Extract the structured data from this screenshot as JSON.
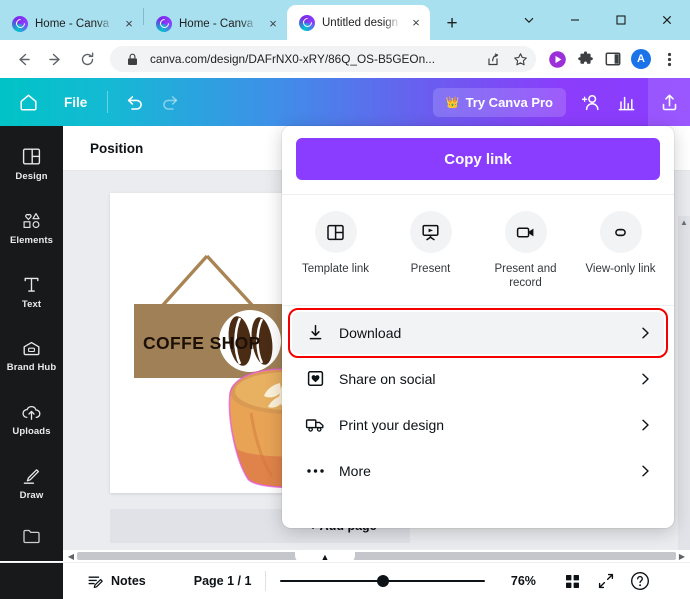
{
  "browser": {
    "tabs": [
      {
        "title": "Home - Canva",
        "active": false,
        "favicon": "canva-favicon",
        "close": "×"
      },
      {
        "title": "Home - Canva",
        "active": false,
        "favicon": "canva-favicon",
        "close": "×"
      },
      {
        "title": "Untitled design",
        "active": true,
        "favicon": "canva-favicon",
        "close": "×"
      }
    ],
    "new_tab_label": "+",
    "window_controls": {
      "tab_search": "chevron-down-icon",
      "minimize": "minimize-icon",
      "maximize": "maximize-icon",
      "close": "close-icon"
    },
    "toolbar": {
      "back": "back-arrow-icon",
      "forward": "forward-arrow-icon",
      "reload": "reload-icon",
      "lock": "lock-icon",
      "url": "canva.com/design/DAFrNX0-xRY/86Q_OS-B5GEOn...",
      "share": "share-icon",
      "bookmark": "star-icon",
      "extensions": [
        "play-circle-icon",
        "puzzle-extension-icon",
        "side-panel-icon"
      ],
      "avatar_initial": "A",
      "menu": "three-dot-menu-icon"
    }
  },
  "canva_header": {
    "home": "home-icon",
    "file_label": "File",
    "undo": "undo-icon",
    "redo": "redo-icon",
    "try_pro_label": "Try Canva Pro",
    "crown": "👑",
    "collaborate": "add-collaborator-icon",
    "analytics": "analytics-icon",
    "share_upload": "share-upload-icon"
  },
  "sidebar": {
    "items": [
      {
        "label": "Design",
        "icon": "design-icon"
      },
      {
        "label": "Elements",
        "icon": "elements-icon"
      },
      {
        "label": "Text",
        "icon": "text-icon"
      },
      {
        "label": "Brand Hub",
        "icon": "brand-hub-icon"
      },
      {
        "label": "Uploads",
        "icon": "uploads-icon"
      },
      {
        "label": "Draw",
        "icon": "draw-icon"
      },
      {
        "label": "",
        "icon": "folder-icon"
      }
    ]
  },
  "editor": {
    "position_label": "Position",
    "add_page_label": "+ Add page",
    "canvas": {
      "sign_text": "COFFE SHOP",
      "sign_color": "#a08056",
      "bean_color": "#4a2c14",
      "cup_color": "#e8a355"
    }
  },
  "share_panel": {
    "copy_link_label": "Copy link",
    "copy_link_color": "#8b3dff",
    "quick_actions": [
      {
        "label": "Template link",
        "icon": "template-link-icon"
      },
      {
        "label": "Present",
        "icon": "present-icon"
      },
      {
        "label": "Present and record",
        "icon": "present-record-icon"
      },
      {
        "label": "View-only link",
        "icon": "view-only-link-icon"
      }
    ],
    "menu_items": [
      {
        "label": "Download",
        "icon": "download-icon",
        "chevron": "›",
        "highlighted": true
      },
      {
        "label": "Share on social",
        "icon": "share-social-icon",
        "chevron": "›",
        "highlighted": false
      },
      {
        "label": "Print your design",
        "icon": "print-truck-icon",
        "chevron": "›",
        "highlighted": false
      },
      {
        "label": "More",
        "icon": "more-dots-icon",
        "chevron": "›",
        "highlighted": false
      }
    ],
    "highlight_color": "#f50000"
  },
  "bottom_bar": {
    "notes_label": "Notes",
    "page_label": "Page 1 / 1",
    "zoom_value": "76%",
    "grid_view": "grid-view-icon",
    "fullscreen": "fullscreen-icon",
    "help": "help-icon"
  }
}
